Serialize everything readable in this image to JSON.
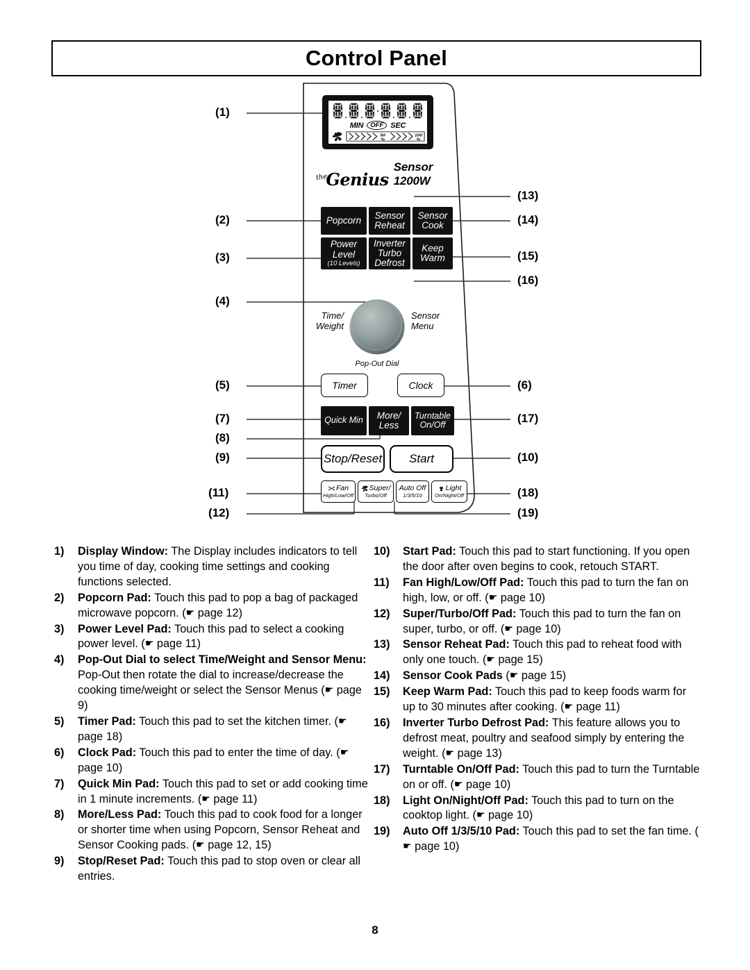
{
  "header": {
    "title": "Control Panel"
  },
  "page_number": "8",
  "panel": {
    "display": {
      "min_label": "MIN",
      "off_label": "OFF",
      "sec_label": "SEC",
      "power_marks": [
        "50\n%",
        "100\n%"
      ],
      "mark_50_num": "50",
      "mark_50_pct": "%",
      "mark_100_num": "100",
      "mark_100_pct": "%"
    },
    "brand": {
      "the": "the",
      "genius": "Genius",
      "model": "Sensor 1200W"
    },
    "pads": {
      "popcorn": "Popcorn",
      "sensor_reheat_l1": "Sensor",
      "sensor_reheat_l2": "Reheat",
      "sensor_cook_l1": "Sensor",
      "sensor_cook_l2": "Cook",
      "power_level_l1": "Power",
      "power_level_l2": "Level",
      "power_level_sub": "(10 Levels)",
      "inverter_l1": "Inverter",
      "inverter_l2": "Turbo",
      "inverter_l3": "Defrost",
      "keep_warm_l1": "Keep",
      "keep_warm_l2": "Warm",
      "timer": "Timer",
      "clock": "Clock",
      "quick_min": "Quick Min",
      "more_less_l1": "More/",
      "more_less_l2": "Less",
      "turntable_l1": "Turntable",
      "turntable_l2": "On/Off",
      "stop_reset": "Stop/Reset",
      "start": "Start",
      "fan_l1": "Fan",
      "fan_l2": "High/Low/Off",
      "super_l1": "Super/",
      "super_l2": "Turbo/Off",
      "auto_off_l1": "Auto Off",
      "auto_off_l2": "1/3/5/10",
      "light_l1": "Light",
      "light_l2": "On/Night/Off"
    },
    "dial": {
      "time_weight_l1": "Time/",
      "time_weight_l2": "Weight",
      "sensor_menu_l1": "Sensor",
      "sensor_menu_l2": "Menu",
      "caption": "Pop-Out Dial"
    },
    "callouts_left": [
      "(1)",
      "(2)",
      "(3)",
      "(4)",
      "(5)",
      "(7)",
      "(8)",
      "(9)",
      "(11)",
      "(12)"
    ],
    "callouts_right": [
      "(13)",
      "(14)",
      "(15)",
      "(16)",
      "(6)",
      "(17)",
      "(10)",
      "(18)",
      "(19)"
    ]
  },
  "descriptions_left": [
    {
      "num": "1)",
      "title": "Display Window:",
      "text": " The Display includes indicators to tell you time of day, cooking time settings and cooking functions selected."
    },
    {
      "num": "2)",
      "title": "Popcorn Pad:",
      "text": " Touch this pad to pop a bag of packaged microwave popcorn. (",
      "ref": "page 12",
      "tail": ")"
    },
    {
      "num": "3)",
      "title": "Power Level Pad:",
      "text": " Touch this pad to select a cooking power level. (",
      "ref": "page 11",
      "tail": ")"
    },
    {
      "num": "4)",
      "title": "Pop-Out Dial to select Time/Weight and Sensor Menu:",
      "text": " Pop-Out then rotate the dial to increase/decrease the cooking time/weight or select the Sensor Menus (",
      "ref": "page 9",
      "tail": ")"
    },
    {
      "num": "5)",
      "title": "Timer Pad:",
      "text": " Touch this pad to set the kitchen timer. (",
      "ref": "page 18",
      "tail": ")"
    },
    {
      "num": "6)",
      "title": "Clock Pad:",
      "text": " Touch this pad to enter the time of day. (",
      "ref": "page 10",
      "tail": ")"
    },
    {
      "num": "7)",
      "title": "Quick Min Pad:",
      "text": " Touch this pad to set or add cooking time in 1 minute increments. (",
      "ref": "page 11",
      "tail": ")"
    },
    {
      "num": "8)",
      "title": "More/Less Pad:",
      "text": " Touch this pad to cook food for a longer or shorter time when using Popcorn, Sensor Reheat and Sensor Cooking pads. (",
      "ref": "page 12, 15",
      "tail": ")"
    },
    {
      "num": "9)",
      "title": "Stop/Reset Pad:",
      "text": " Touch this pad to stop oven or clear all entries."
    }
  ],
  "descriptions_right": [
    {
      "num": "10)",
      "title": "Start Pad:",
      "text": " Touch this pad to start functioning. If you open the door after oven begins to cook, retouch START."
    },
    {
      "num": "11)",
      "title": "Fan High/Low/Off Pad:",
      "text": " Touch this pad to turn the fan on high, low, or off. (",
      "ref": "page 10",
      "tail": ")"
    },
    {
      "num": "12)",
      "title": "Super/Turbo/Off Pad:",
      "text": " Touch this pad to turn the fan on super, turbo, or off. (",
      "ref": "page 10",
      "tail": ")"
    },
    {
      "num": "13)",
      "title": "Sensor Reheat Pad:",
      "text": " Touch this pad to reheat food with only one touch. (",
      "ref": "page 15",
      "tail": ")"
    },
    {
      "num": "14)",
      "title": "Sensor Cook Pads",
      "text": " (",
      "ref": "page 15",
      "tail": ")"
    },
    {
      "num": "15)",
      "title": "Keep Warm Pad:",
      "text": " Touch this pad to keep foods warm for up to 30 minutes after cooking. (",
      "ref": "page 11",
      "tail": ")"
    },
    {
      "num": "16)",
      "title": "Inverter Turbo Defrost Pad:",
      "text": " This feature allows you to defrost meat, poultry and seafood simply by entering the weight. (",
      "ref": "page 13",
      "tail": ")"
    },
    {
      "num": "17)",
      "title": "Turntable On/Off Pad:",
      "text": " Touch this pad to turn the Turntable on or off. (",
      "ref": "page 10",
      "tail": ")"
    },
    {
      "num": "18)",
      "title": "Light On/Night/Off Pad:",
      "text": " Touch this pad to turn on the cooktop light. (",
      "ref": "page 10",
      "tail": ")"
    },
    {
      "num": "19)",
      "title": "Auto Off 1/3/5/10 Pad:",
      "text": " Touch this pad to set the fan time. (",
      "ref": "page 10",
      "tail": ")"
    }
  ]
}
